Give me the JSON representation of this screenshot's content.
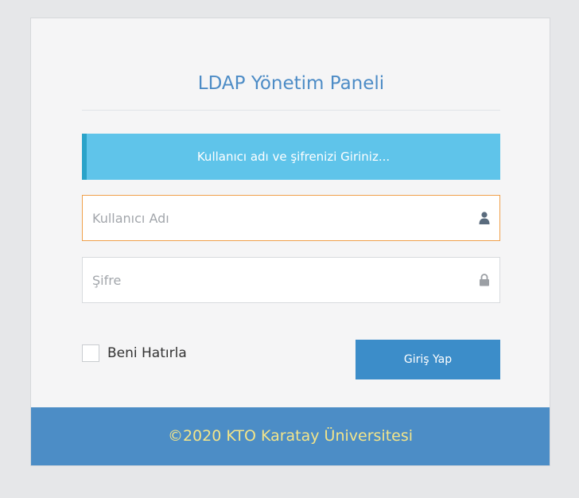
{
  "panel": {
    "title": "LDAP Yönetim Paneli",
    "info_message": "Kullanıcı adı ve şifrenizi Giriniz..."
  },
  "form": {
    "username_placeholder": "Kullanıcı Adı",
    "username_value": "",
    "username_icon": "user-icon",
    "password_placeholder": "Şifre",
    "password_value": "",
    "password_icon": "lock-icon",
    "remember_label": "Beni Hatırla",
    "remember_checked": false,
    "login_label": "Giriş Yap"
  },
  "footer": {
    "copyright": "©2020 KTO Karatay Üniversitesi"
  },
  "colors": {
    "title": "#4d8cc6",
    "info_bar": "#5fc4ea",
    "info_bar_accent": "#2aa3c9",
    "focus_border": "#f0a04b",
    "button": "#3c8dc9",
    "footer_bg": "#4c8dc6",
    "footer_text": "#f3e58a"
  }
}
